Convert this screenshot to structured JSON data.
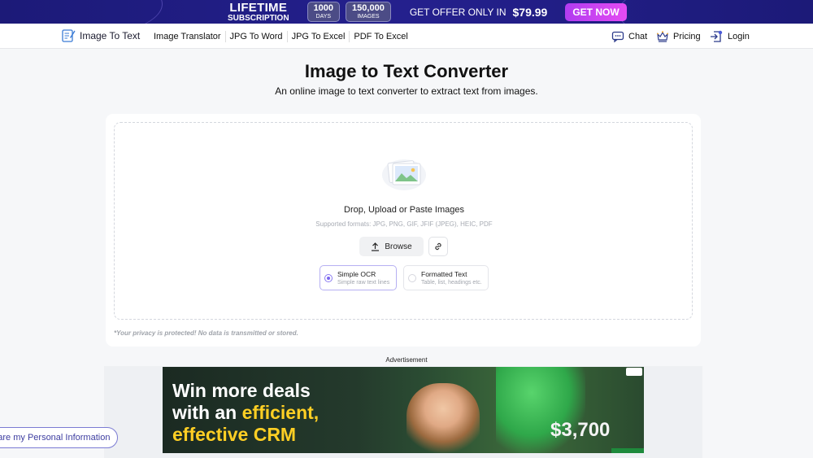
{
  "promo": {
    "title_line1": "LIFETIME",
    "title_line2": "SUBSCRIPTION",
    "badges": [
      {
        "number": "1000",
        "unit": "DAYS"
      },
      {
        "number": "150,000",
        "unit": "IMAGES"
      }
    ],
    "offer_text": "GET OFFER ONLY IN",
    "price": "$79.99",
    "cta": "GET NOW"
  },
  "nav": {
    "brand": "Image To Text",
    "links": [
      "Image Translator",
      "JPG To Word",
      "JPG To Excel",
      "PDF To Excel"
    ],
    "chat": "Chat",
    "pricing": "Pricing",
    "login": "Login"
  },
  "hero": {
    "title": "Image to Text Converter",
    "subtitle": "An online image to text converter to extract text from images."
  },
  "upload": {
    "drop_title": "Drop, Upload or Paste Images",
    "formats": "Supported formats: JPG, PNG, GIF, JFIF (JPEG), HEIC, PDF",
    "browse": "Browse",
    "modes": [
      {
        "title": "Simple OCR",
        "subtitle": "Simple raw text lines",
        "selected": true
      },
      {
        "title": "Formatted Text",
        "subtitle": "Table, list, headings etc.",
        "selected": false
      }
    ],
    "privacy": "*Your privacy is protected! No data is transmitted or stored."
  },
  "ad": {
    "label": "Advertisement",
    "line1": "Win more deals",
    "line2_prefix": "with an ",
    "line2_highlight": "efficient,",
    "line3": "effective CRM",
    "amount": "$3,700"
  },
  "footer": {
    "ccpa": "t share my Personal Information"
  },
  "colors": {
    "promo_bg": "#1c1a78",
    "cta": "#c93ff1",
    "accent": "#7a66ef",
    "ad_highlight": "#ffcf24"
  }
}
